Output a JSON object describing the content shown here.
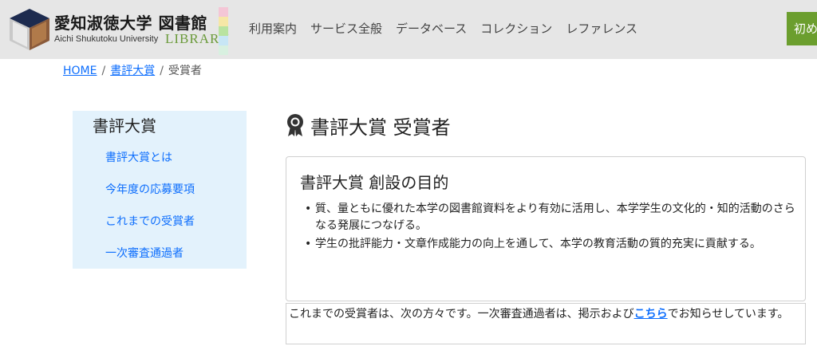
{
  "header": {
    "logo_title": "愛知淑徳大学 図書館",
    "logo_subtitle": "Aichi Shukutoku University",
    "logo_library": "LIBRARY",
    "colors": {
      "background": "#e6e6e6",
      "accent_green": "#6b9e2e"
    },
    "nav": [
      "利用案内",
      "サービス全般",
      "データベース",
      "コレクション",
      "レファレンス"
    ],
    "first_button": "初め"
  },
  "breadcrumb": {
    "home": "HOME",
    "separator": "/",
    "parent": "書評大賞",
    "current": "受賞者"
  },
  "sidebar": {
    "title": "書評大賞",
    "items": [
      "書評大賞とは",
      "今年度の応募要項",
      "これまでの受賞者",
      "一次審査通過者"
    ],
    "background": "#e3f2fc"
  },
  "main": {
    "title_icon": "award-ribbon-icon",
    "title": "書評大賞 受賞者",
    "card": {
      "title": "書評大賞 創設の目的",
      "bullets": [
        "質、量ともに優れた本学の図書館資料をより有効に活用し、本学学生の文化的・知的活動のさらなる発展につなげる。",
        "学生の批評能力・文章作成能力の向上を通して、本学の教育活動の質的充実に貢献する。"
      ]
    },
    "note": {
      "before": "これまでの受賞者は、次の方々です。一次審査通過者は、掲示および",
      "link": "こちら",
      "after": "でお知らせしています。"
    }
  }
}
